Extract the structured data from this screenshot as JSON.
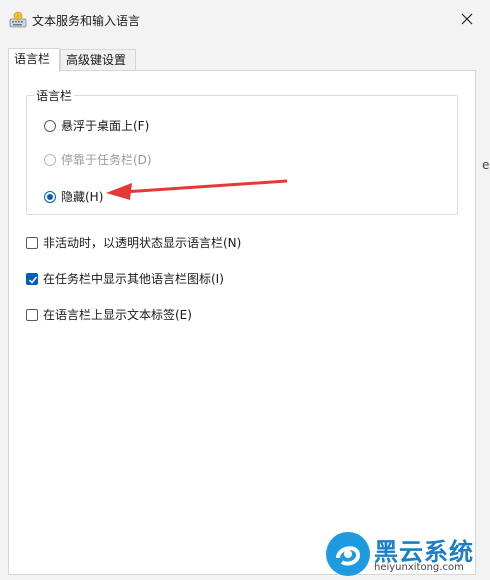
{
  "window": {
    "title": "文本服务和输入语言",
    "app_icon": "keyboard-globe-icon",
    "close_icon": "close-icon"
  },
  "tabs": [
    {
      "label": "语言栏",
      "active": true
    },
    {
      "label": "高级键设置",
      "active": false
    }
  ],
  "language_bar_group": {
    "title": "语言栏",
    "options": [
      {
        "label": "悬浮于桌面上(F)",
        "checked": false,
        "disabled": false
      },
      {
        "label": "停靠于任务栏(D)",
        "checked": false,
        "disabled": true
      },
      {
        "label": "隐藏(H)",
        "checked": true,
        "disabled": false
      }
    ]
  },
  "checkboxes": [
    {
      "label": "非活动时，以透明状态显示语言栏(N)",
      "checked": false
    },
    {
      "label": "在任务栏中显示其他语言栏图标(I)",
      "checked": true
    },
    {
      "label": "在语言栏上显示文本标签(E)",
      "checked": false
    }
  ],
  "edge_fragment": "e",
  "annotation": {
    "type": "red-arrow",
    "color": "#e53935"
  },
  "watermark": {
    "title": "黑云系统",
    "url": "heiyunxitong.com",
    "color": "#1a7fc4"
  },
  "colors": {
    "accent": "#005fb8",
    "background": "#f3f3f3",
    "panel": "#ffffff"
  }
}
